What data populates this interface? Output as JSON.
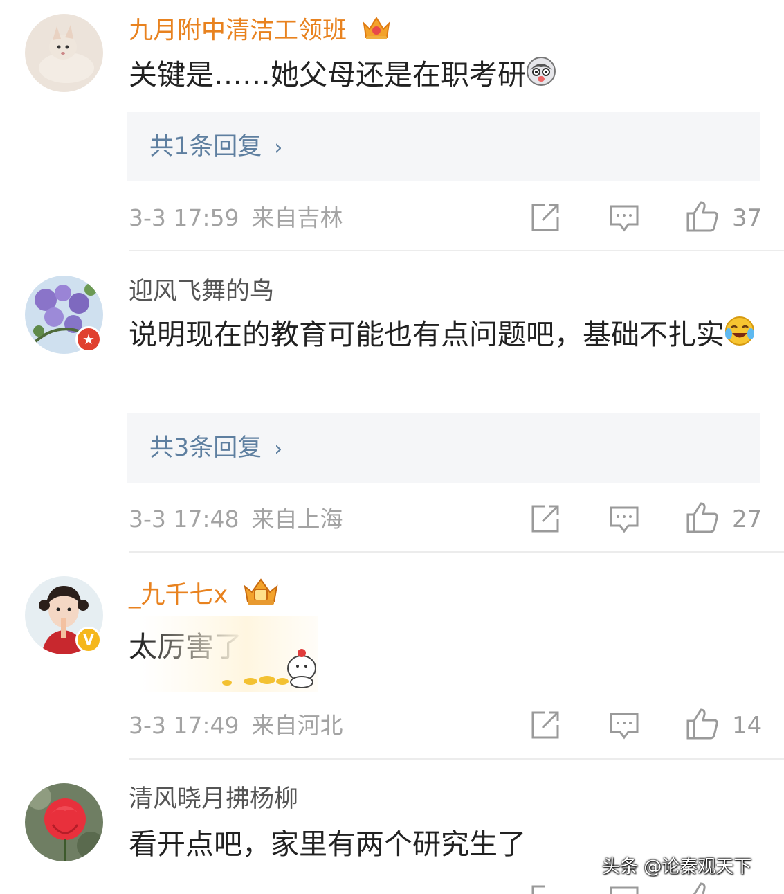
{
  "comments": [
    {
      "username": "九月附中清洁工领班",
      "text": "关键是……她父母还是在职考研",
      "reply_label": "共1条回复",
      "time": "3-3 17:59",
      "location": "来自吉林",
      "likes": "37"
    },
    {
      "username": "迎风飞舞的鸟",
      "text": "说明现在的教育可能也有点问题吧，基础不扎实",
      "reply_label": "共3条回复",
      "time": "3-3 17:48",
      "location": "来自上海",
      "likes": "27"
    },
    {
      "username": "_九千七x",
      "text": "太厉害了",
      "time": "3-3 17:49",
      "location": "来自河北",
      "likes": "14"
    },
    {
      "username": "清风晓月拂杨柳",
      "text": "看开点吧，家里有两个研究生了"
    }
  ],
  "watermark": "头条 @论秦观天下",
  "colors": {
    "vip_name": "#e8821f",
    "reply_link": "#5e7fa0",
    "meta": "#a3a3a3"
  },
  "icons": [
    "share-icon",
    "comment-icon",
    "like-icon",
    "crown-icon",
    "verified-badge-icon",
    "star-badge-icon",
    "chevron-right-icon"
  ]
}
